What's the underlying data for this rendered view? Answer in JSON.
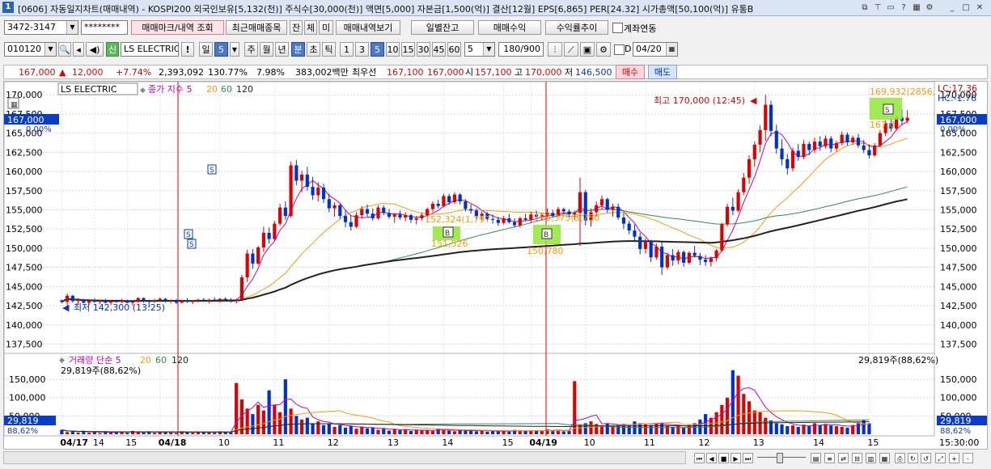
{
  "title_bar": {
    "icon": "1",
    "title": "[0606] 자동일지차트(매매내역) - KOSPI200 외국인보유[5,132(천)] 주식수[30,000(천)] 액면[5,000] 자본금[1,500(억)] 결산[12월] EPS[6,865] PER[24.32] 시가총액[50,100(억)] 유통B"
  },
  "toolbar1": {
    "account": "3472-3147",
    "password": "********",
    "tab_trade_mark": "매매마크/내역 조회",
    "recent_stocks": "최근매매종목",
    "btn_jan": "잔",
    "btn_che": "체",
    "btn_mi": "미",
    "view_history": "매매내역보기",
    "daily_balance": "일별잔고",
    "trade_profit": "매매수익",
    "return_trend": "수익률추이",
    "account_link": "계좌연동"
  },
  "toolbar2": {
    "code": "010120",
    "sin": "신",
    "stock_name": "LS ELECTRIC",
    "excl": "!",
    "day": "일",
    "period_num": "5",
    "week": "주",
    "month": "월",
    "year": "년",
    "minute": "분",
    "second": "초",
    "tick": "틱",
    "intervals": [
      "1",
      "3",
      "5",
      "10",
      "15",
      "30",
      "45",
      "60"
    ],
    "interval_value": "5",
    "count": "180/900",
    "d_label": "D",
    "date": "04/20"
  },
  "quote": {
    "price": "167,000",
    "change": "12,000",
    "change_pct": "+7.74%",
    "volume": "2,393,092",
    "vol_ratio": "130.77%",
    "turnover": "7.98%",
    "amount": "383,002백만",
    "best_bid_label": "최우선",
    "bid1": "167,100",
    "bid2": "167,000",
    "open_label": "시",
    "open": "157,100",
    "high_label": "고",
    "high": "170,000",
    "low_label": "저",
    "low": "146,500",
    "buy_button": "매수",
    "sell_button": "매도"
  },
  "chart_labels": {
    "stock_name": "LS ELECTRIC",
    "legend_price": "종가 지수 5",
    "ma20": "20",
    "ma60": "60",
    "ma120": "120",
    "lc": "LC:17.36",
    "hc": "HC:-1.76",
    "current_price": "167,000",
    "current_pct": "0.00%",
    "high_annotation": "최고 170,000 (12:45)",
    "low_annotation": "최저 142,300 (13:25)",
    "buy_avg_1": "151,526",
    "buy_avg_2": "150,780",
    "cost_line_1": "152,324(1,797",
    "cost_line_2": "153,375(3,750",
    "sell_avg": "169,932(2856,",
    "sell_small": "167,0",
    "vol_legend": "거래량 단순 5",
    "vol_ma20": "20",
    "vol_ma60": "60",
    "vol_ma120": "120",
    "vol_current": "29,819주(88,62%)",
    "vol_current_right": "29,819주(88,62%)",
    "vol_axis_current": "29,819",
    "vol_axis_pct": "88,62%",
    "time_label": "15:30:00"
  },
  "chart_data": {
    "type": "candlestick",
    "price_axis_ticks": [
      "170,000",
      "167,500",
      "165,000",
      "162,500",
      "160,000",
      "157,500",
      "155,000",
      "152,500",
      "150,000",
      "147,500",
      "145,000",
      "142,500",
      "140,000",
      "137,500"
    ],
    "volume_axis_ticks": [
      "150,000",
      "100,000",
      "50,000"
    ],
    "x_tick_labels": [
      "04/17",
      "14",
      "15",
      "04/18",
      "10",
      "11",
      "12",
      "13",
      "14",
      "15",
      "04/19",
      "10",
      "11",
      "12",
      "13",
      "14",
      "15"
    ],
    "candles": [
      [
        143200,
        143300,
        142800,
        143000
      ],
      [
        143000,
        144100,
        142500,
        143800
      ],
      [
        143800,
        143900,
        142900,
        143100
      ],
      [
        143100,
        143500,
        142700,
        143300
      ],
      [
        143300,
        143400,
        142800,
        142900
      ],
      [
        142900,
        143300,
        142600,
        143200
      ],
      [
        143200,
        143500,
        142900,
        143000
      ],
      [
        143000,
        143300,
        142700,
        143200
      ],
      [
        143200,
        143400,
        142800,
        142900
      ],
      [
        142900,
        143200,
        142600,
        143100
      ],
      [
        143100,
        143300,
        142900,
        143000
      ],
      [
        143000,
        143400,
        142800,
        143200
      ],
      [
        143200,
        143300,
        142800,
        142900
      ],
      [
        142900,
        143100,
        142500,
        143000
      ],
      [
        143000,
        143600,
        142900,
        143500
      ],
      [
        143500,
        143600,
        142900,
        143100
      ],
      [
        143100,
        143300,
        142300,
        143000
      ],
      [
        143000,
        143400,
        142900,
        143200
      ],
      [
        143200,
        143600,
        143000,
        143400
      ],
      [
        143400,
        143500,
        142900,
        143100
      ],
      [
        143100,
        143300,
        142800,
        143200
      ],
      [
        143200,
        143400,
        142700,
        142900
      ],
      [
        142900,
        143300,
        142800,
        143200
      ],
      [
        143200,
        143500,
        142900,
        143000
      ],
      [
        143000,
        143200,
        142700,
        143100
      ],
      [
        143100,
        143400,
        142900,
        143300
      ],
      [
        143300,
        143500,
        143000,
        143100
      ],
      [
        143100,
        143400,
        142800,
        143300
      ],
      [
        143300,
        143600,
        143000,
        143200
      ],
      [
        143200,
        143500,
        142900,
        143400
      ],
      [
        143400,
        143600,
        143100,
        143300
      ],
      [
        143300,
        143500,
        142900,
        143100
      ],
      [
        143100,
        143400,
        142800,
        143300
      ],
      [
        143300,
        146500,
        143200,
        146200
      ],
      [
        146200,
        149800,
        145600,
        149300
      ],
      [
        149300,
        149900,
        147300,
        148000
      ],
      [
        148000,
        150300,
        147800,
        150100
      ],
      [
        150100,
        152800,
        149500,
        152000
      ],
      [
        152000,
        152700,
        150600,
        151200
      ],
      [
        151200,
        153600,
        151000,
        153200
      ],
      [
        153200,
        155800,
        152900,
        155300
      ],
      [
        155300,
        156100,
        153700,
        154200
      ],
      [
        154200,
        161300,
        154000,
        160800
      ],
      [
        160800,
        161500,
        158200,
        158800
      ],
      [
        158800,
        160100,
        157300,
        159600
      ],
      [
        159600,
        160600,
        157500,
        158000
      ],
      [
        158000,
        159300,
        156300,
        156900
      ],
      [
        156900,
        158600,
        156100,
        157900
      ],
      [
        157900,
        158400,
        155900,
        156400
      ],
      [
        156400,
        157100,
        154700,
        155200
      ],
      [
        155200,
        156000,
        154100,
        155600
      ],
      [
        155600,
        155800,
        153800,
        154200
      ],
      [
        154200,
        154900,
        152700,
        153400
      ],
      [
        153400,
        154300,
        152300,
        152800
      ],
      [
        152800,
        154700,
        152600,
        154300
      ],
      [
        154300,
        155500,
        153900,
        155100
      ],
      [
        155100,
        155700,
        154100,
        154500
      ],
      [
        154500,
        155200,
        153600,
        153900
      ],
      [
        153900,
        155600,
        153700,
        155300
      ],
      [
        155300,
        155600,
        154300,
        154600
      ],
      [
        154600,
        155100,
        153800,
        154100
      ],
      [
        154100,
        154600,
        153300,
        154400
      ],
      [
        154400,
        154900,
        153700,
        154000
      ],
      [
        154000,
        154700,
        153500,
        154300
      ],
      [
        154300,
        154500,
        153300,
        153700
      ],
      [
        153700,
        154200,
        153100,
        153900
      ],
      [
        153900,
        154600,
        153600,
        154300
      ],
      [
        154300,
        155300,
        154100,
        155100
      ],
      [
        155100,
        156100,
        154700,
        155800
      ],
      [
        155800,
        156300,
        155200,
        155500
      ],
      [
        155500,
        157100,
        155300,
        156800
      ],
      [
        156800,
        157100,
        155600,
        156000
      ],
      [
        156000,
        157300,
        155800,
        157000
      ],
      [
        157000,
        157200,
        155700,
        156100
      ],
      [
        156100,
        156400,
        154800,
        155100
      ],
      [
        155100,
        155700,
        154500,
        154900
      ],
      [
        154900,
        155200,
        153800,
        154200
      ],
      [
        154200,
        154800,
        153600,
        154500
      ],
      [
        154500,
        154700,
        153500,
        153800
      ],
      [
        153800,
        154400,
        153200,
        153700
      ],
      [
        153700,
        154100,
        152900,
        153300
      ],
      [
        153300,
        154200,
        153100,
        153900
      ],
      [
        153900,
        154500,
        153200,
        153400
      ],
      [
        153400,
        153900,
        152700,
        153000
      ],
      [
        153000,
        154100,
        152700,
        153900
      ],
      [
        153900,
        154500,
        153500,
        153700
      ],
      [
        153700,
        154800,
        153300,
        154400
      ],
      [
        154400,
        154900,
        153900,
        154100
      ],
      [
        154100,
        154600,
        153700,
        154300
      ],
      [
        154300,
        155200,
        154100,
        154600
      ],
      [
        154600,
        155000,
        154000,
        154200
      ],
      [
        154200,
        155400,
        154100,
        155100
      ],
      [
        155100,
        155300,
        154500,
        154800
      ],
      [
        154800,
        155100,
        154000,
        154400
      ],
      [
        154400,
        154900,
        153700,
        154600
      ],
      [
        154600,
        159200,
        150300,
        157300
      ],
      [
        157300,
        157600,
        153000,
        153600
      ],
      [
        153600,
        155200,
        152800,
        154700
      ],
      [
        154700,
        156100,
        154100,
        155600
      ],
      [
        155600,
        156900,
        155000,
        156400
      ],
      [
        156400,
        156600,
        154600,
        155000
      ],
      [
        155000,
        155800,
        154100,
        155400
      ],
      [
        155400,
        155800,
        153700,
        154000
      ],
      [
        154000,
        154600,
        152500,
        153200
      ],
      [
        153200,
        153600,
        151800,
        152300
      ],
      [
        152300,
        153100,
        151000,
        151500
      ],
      [
        151500,
        152000,
        149200,
        149900
      ],
      [
        149900,
        151300,
        149300,
        150800
      ],
      [
        150800,
        151100,
        148200,
        148800
      ],
      [
        148800,
        150600,
        148500,
        150200
      ],
      [
        150200,
        150800,
        146500,
        147500
      ],
      [
        147500,
        149400,
        147200,
        149100
      ],
      [
        149100,
        149900,
        147700,
        148400
      ],
      [
        148400,
        149800,
        147900,
        149500
      ],
      [
        149500,
        149700,
        147600,
        148100
      ],
      [
        148100,
        149600,
        147900,
        149400
      ],
      [
        149400,
        150300,
        148800,
        149000
      ],
      [
        149000,
        149400,
        147800,
        148500
      ],
      [
        148500,
        149100,
        147700,
        148200
      ],
      [
        148200,
        148900,
        147600,
        148700
      ],
      [
        148700,
        149900,
        148300,
        149700
      ],
      [
        149700,
        153300,
        149500,
        153100
      ],
      [
        153100,
        155800,
        152800,
        155400
      ],
      [
        155400,
        156600,
        154300,
        154900
      ],
      [
        154900,
        157700,
        154700,
        157300
      ],
      [
        157300,
        159800,
        156900,
        159200
      ],
      [
        159200,
        162100,
        158400,
        161600
      ],
      [
        161600,
        163900,
        160600,
        163500
      ],
      [
        163500,
        166000,
        162500,
        165400
      ],
      [
        165400,
        170000,
        164000,
        168700
      ],
      [
        168700,
        169200,
        164600,
        165300
      ],
      [
        165300,
        166100,
        162300,
        163000
      ],
      [
        163000,
        164200,
        160800,
        161600
      ],
      [
        161600,
        162300,
        159600,
        160400
      ],
      [
        160400,
        163100,
        160000,
        162700
      ],
      [
        162700,
        163600,
        161400,
        161900
      ],
      [
        161900,
        164100,
        161600,
        163600
      ],
      [
        163600,
        163900,
        162100,
        162800
      ],
      [
        162800,
        164400,
        162400,
        163900
      ],
      [
        163900,
        164600,
        162700,
        163300
      ],
      [
        163300,
        164700,
        163000,
        164300
      ],
      [
        164300,
        164600,
        162500,
        163000
      ],
      [
        163000,
        164000,
        162600,
        163700
      ],
      [
        163700,
        165200,
        163400,
        164800
      ],
      [
        164800,
        165100,
        163400,
        163800
      ],
      [
        163800,
        164700,
        163500,
        164400
      ],
      [
        164400,
        164900,
        163100,
        163400
      ],
      [
        163400,
        164100,
        162400,
        162800
      ],
      [
        162800,
        163500,
        161700,
        162100
      ],
      [
        162100,
        163700,
        161900,
        163400
      ],
      [
        163400,
        165400,
        163200,
        165000
      ],
      [
        165000,
        166700,
        164600,
        166300
      ],
      [
        166300,
        166900,
        165200,
        165600
      ],
      [
        165600,
        167300,
        165300,
        167000
      ],
      [
        167000,
        168100,
        166100,
        166600
      ],
      [
        166600,
        168000,
        166300,
        167000
      ]
    ],
    "volumes": [
      12000,
      6000,
      8000,
      5000,
      9000,
      4000,
      7000,
      3000,
      8000,
      5000,
      6000,
      7000,
      4000,
      9000,
      6000,
      5000,
      8000,
      4000,
      6000,
      7000,
      5000,
      3000,
      8000,
      6000,
      4000,
      7000,
      5000,
      6000,
      4000,
      8000,
      6000,
      5000,
      140000,
      95000,
      70000,
      55000,
      80000,
      65000,
      120000,
      80000,
      60000,
      150000,
      70000,
      50000,
      40000,
      45000,
      30000,
      35000,
      25000,
      30000,
      20000,
      25000,
      18000,
      22000,
      15000,
      20000,
      16000,
      18000,
      12000,
      15000,
      10000,
      14000,
      11000,
      13000,
      9000,
      12000,
      10000,
      11000,
      9000,
      15000,
      12000,
      10000,
      8000,
      11000,
      9000,
      13000,
      8000,
      10000,
      7000,
      9000,
      8000,
      10000,
      7000,
      12000,
      8000,
      9000,
      10000,
      11000,
      9000,
      13000,
      10000,
      12000,
      8000,
      9000,
      145000,
      25000,
      30000,
      35000,
      28000,
      24000,
      30000,
      22000,
      26000,
      28000,
      24000,
      35000,
      30000,
      27000,
      25000,
      28000,
      32000,
      24000,
      20000,
      22000,
      18000,
      25000,
      30000,
      40000,
      55000,
      45000,
      60000,
      80000,
      100000,
      175000,
      160000,
      110000,
      90000,
      65000,
      60000,
      45000,
      38000,
      30000,
      27000,
      22000,
      24000,
      20000,
      26000,
      22000,
      30000,
      25000,
      28000,
      24000,
      22000,
      20000,
      18000,
      25000,
      32000,
      38000,
      29819
    ],
    "ma_series": [
      {
        "name": "5",
        "color": "#c000c0"
      },
      {
        "name": "20",
        "color": "#ff9900"
      },
      {
        "name": "60",
        "color": "#2e8b57"
      },
      {
        "name": "120",
        "color": "#222222"
      }
    ],
    "ylim_price": [
      136500,
      171500
    ],
    "ylim_volume": [
      0,
      190000
    ]
  },
  "status": {
    "zoom_in": "+",
    "zoom_out": "-"
  }
}
